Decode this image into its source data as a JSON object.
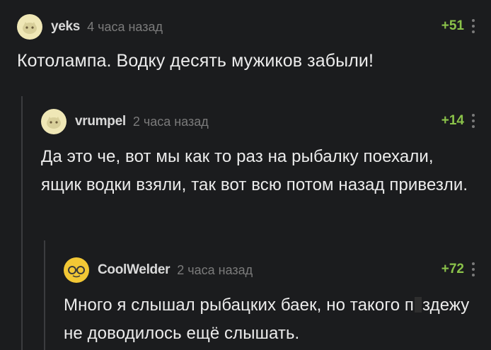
{
  "comments": [
    {
      "user": "yeks",
      "time": "4 часа назад",
      "score": "+51",
      "text": "Котолампа. Водку десять мужиков забыли!"
    },
    {
      "user": "vrumpel",
      "time": "2 часа назад",
      "score": "+14",
      "text": "Да это че, вот мы как то раз на рыбалку поехали, ящик водки взяли, так вот всю потом назад привезли."
    },
    {
      "user": "CoolWelder",
      "time": "2 часа назад",
      "score": "+72",
      "text_before": "Много я слышал рыбацких баек, но такого п",
      "text_after": "здежу не доводилось ещё слышать."
    }
  ],
  "colors": {
    "background": "#1b1c1e",
    "score": "#8bc34a",
    "muted": "#7b7b7b"
  }
}
